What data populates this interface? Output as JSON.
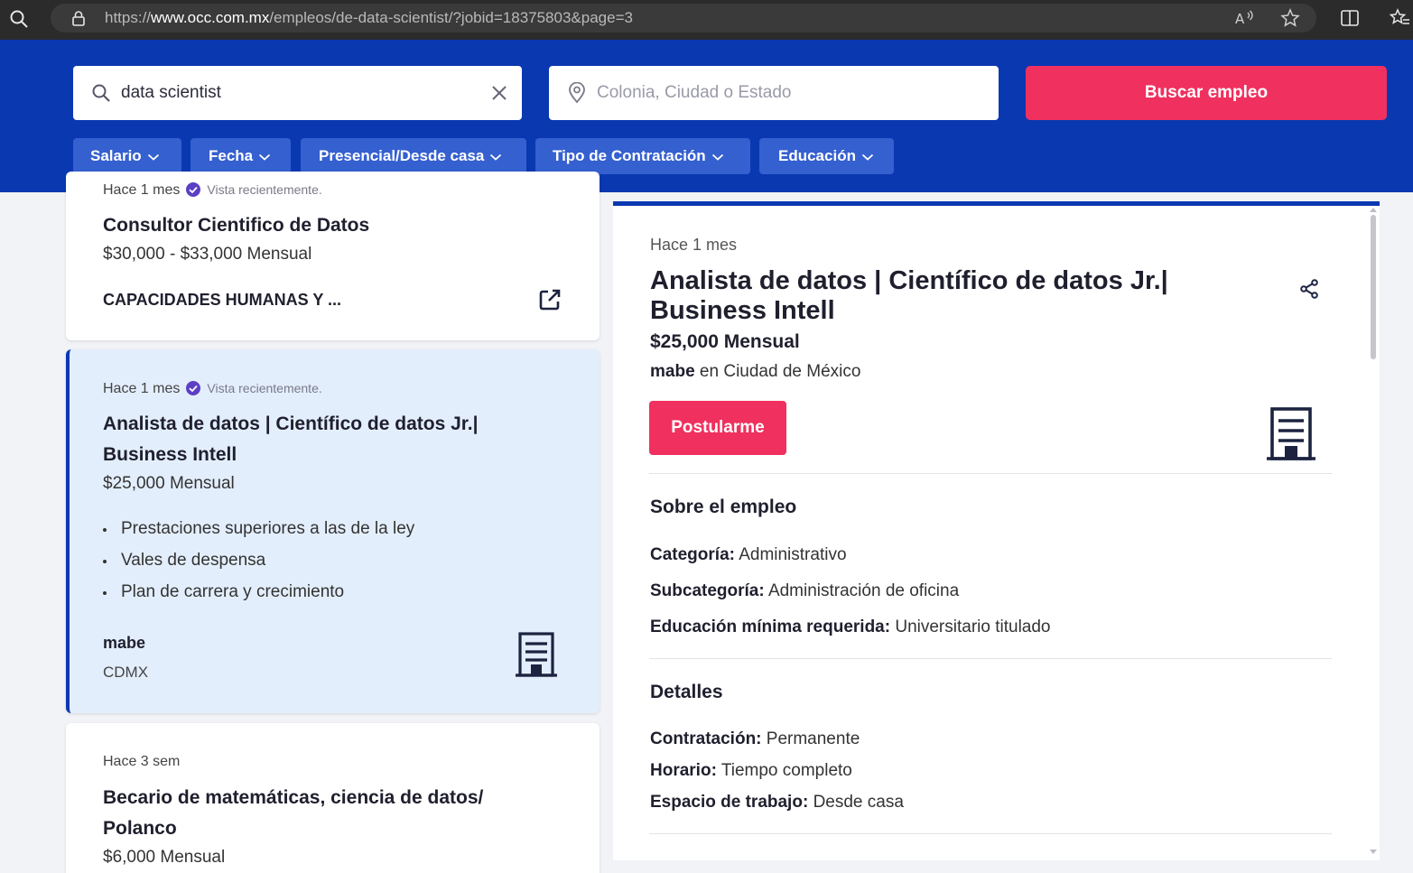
{
  "browser": {
    "url_prefix": "https://",
    "url_host": "www.occ.com.mx",
    "url_path": "/empleos/de-data-scientist/?jobid=18375803&page=3"
  },
  "search": {
    "query": "data scientist",
    "location_placeholder": "Colonia, Ciudad o Estado",
    "button_label": "Buscar empleo"
  },
  "filters": [
    "Salario",
    "Fecha",
    "Presencial/Desde casa",
    "Tipo de Contratación",
    "Educación"
  ],
  "jobs": [
    {
      "posted": "Hace 1 mes",
      "viewed_label": "Vista recientemente.",
      "title": "Consultor Cientifico de Datos",
      "salary": "$30,000 - $33,000 Mensual",
      "company": "CAPACIDADES HUMANAS Y ..."
    },
    {
      "posted": "Hace 1 mes",
      "viewed_label": "Vista recientemente.",
      "title_line1": "Analista de datos | Científico de datos Jr.|",
      "title_line2": "Business Intell",
      "salary": "$25,000 Mensual",
      "benefits": [
        "Prestaciones superiores a las de la ley",
        "Vales de despensa",
        "Plan de carrera y crecimiento"
      ],
      "company": "mabe",
      "location": "CDMX"
    },
    {
      "posted": "Hace 3 sem",
      "title_line1": "Becario de matemáticas, ciencia de datos/",
      "title_line2": "Polanco",
      "salary": "$6,000 Mensual"
    }
  ],
  "detail": {
    "posted": "Hace 1 mes",
    "title_line1": "Analista de datos | Científico de datos Jr.|",
    "title_line2": "Business Intell",
    "salary": "$25,000 Mensual",
    "company": "mabe",
    "location_prefix": "en",
    "location": "Ciudad de México",
    "apply_label": "Postularme",
    "about_heading": "Sobre el empleo",
    "about": [
      {
        "label": "Categoría:",
        "value": "Administrativo"
      },
      {
        "label": "Subcategoría:",
        "value": "Administración de oficina"
      },
      {
        "label": "Educación mínima requerida:",
        "value": "Universitario titulado"
      }
    ],
    "details_heading": "Detalles",
    "details": [
      {
        "label": "Contratación:",
        "value": "Permanente"
      },
      {
        "label": "Horario:",
        "value": "Tiempo completo"
      },
      {
        "label": "Espacio de trabajo:",
        "value": "Desde casa"
      }
    ]
  },
  "colors": {
    "brand_blue": "#0a38b1",
    "accent_pink": "#f0305e",
    "selected_card": "#e3eefc"
  }
}
